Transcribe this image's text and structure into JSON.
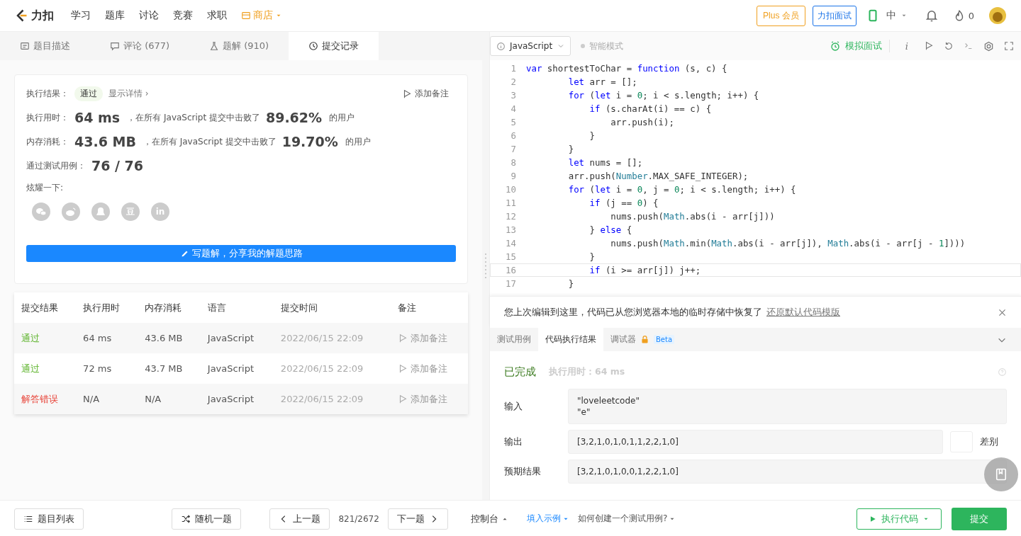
{
  "nav": {
    "logo": "力扣",
    "items": [
      {
        "label": "学习"
      },
      {
        "label": "题库"
      },
      {
        "label": "讨论"
      },
      {
        "label": "竞赛"
      },
      {
        "label": "求职"
      }
    ],
    "store": "商店",
    "plus": "Plus 会员",
    "interview": "力扣面试",
    "lang": "中",
    "points": "0"
  },
  "left_tabs": [
    {
      "label": "题目描述",
      "selected": false
    },
    {
      "label": "评论 (677)",
      "selected": false
    },
    {
      "label": "题解 (910)",
      "selected": false
    },
    {
      "label": "提交记录",
      "selected": true
    }
  ],
  "result": {
    "label": "执行结果：",
    "status": "通过",
    "details": "显示详情 ›",
    "note": "添加备注"
  },
  "stats": [
    {
      "label": "执行用时：",
      "value": "64 ms",
      "mid": "，在所有 JavaScript 提交中击败了",
      "pct": "89.62%",
      "suffix": "的用户"
    },
    {
      "label": "内存消耗：",
      "value": "43.6 MB",
      "mid": "，在所有 JavaScript 提交中击败了",
      "pct": "19.70%",
      "suffix": "的用户"
    }
  ],
  "cases": {
    "label": "通过测试用例：",
    "value": "76 / 76"
  },
  "share_label": "炫耀一下:",
  "share_glyphs": [
    "豆",
    "in"
  ],
  "write_button": "写题解，分享我的解题思路",
  "table": {
    "columns": [
      "提交结果",
      "执行用时",
      "内存消耗",
      "语言",
      "提交时间",
      "备注"
    ],
    "rows": [
      {
        "status": "通过",
        "kind": "pass",
        "time": "64 ms",
        "memory": "43.6 MB",
        "lang": "JavaScript",
        "submitted": "2022/06/15 22:09",
        "note": "添加备注"
      },
      {
        "status": "通过",
        "kind": "pass",
        "time": "72 ms",
        "memory": "43.7 MB",
        "lang": "JavaScript",
        "submitted": "2022/06/15 22:09",
        "note": "添加备注"
      },
      {
        "status": "解答错误",
        "kind": "fail",
        "time": "N/A",
        "memory": "N/A",
        "lang": "JavaScript",
        "submitted": "2022/06/15 22:09",
        "note": "添加备注"
      }
    ]
  },
  "editor": {
    "language": "JavaScript",
    "smart_mode": "智能模式",
    "mock": "模拟面试",
    "info_glyph": "i",
    "lines": [
      {
        "n": "1",
        "current": false,
        "seg": [
          {
            "text": "var",
            "kind": "kw"
          },
          {
            "text": " shortestToChar = "
          },
          {
            "text": "function",
            "kind": "kw"
          },
          {
            "text": " (s, c) {"
          }
        ]
      },
      {
        "n": "2",
        "current": false,
        "seg": [
          {
            "text": "        let",
            "kind": "kw"
          },
          {
            "text": " arr = [];"
          }
        ]
      },
      {
        "n": "3",
        "current": false,
        "seg": [
          {
            "text": "        for",
            "kind": "kw"
          },
          {
            "text": " ("
          },
          {
            "text": "let",
            "kind": "kw"
          },
          {
            "text": " i = "
          },
          {
            "text": "0",
            "kind": "num"
          },
          {
            "text": "; i < s.length; i++) {"
          }
        ]
      },
      {
        "n": "4",
        "current": false,
        "seg": [
          {
            "text": "            if",
            "kind": "kw"
          },
          {
            "text": " (s.charAt(i) == c) {"
          }
        ]
      },
      {
        "n": "5",
        "current": false,
        "seg": [
          {
            "text": "                arr.push(i);"
          }
        ]
      },
      {
        "n": "6",
        "current": false,
        "seg": [
          {
            "text": "            }"
          }
        ]
      },
      {
        "n": "7",
        "current": false,
        "seg": [
          {
            "text": "        }"
          }
        ]
      },
      {
        "n": "8",
        "current": false,
        "seg": [
          {
            "text": "        let",
            "kind": "kw"
          },
          {
            "text": " nums = [];"
          }
        ]
      },
      {
        "n": "9",
        "current": false,
        "seg": [
          {
            "text": "        arr.push("
          },
          {
            "text": "Number",
            "kind": "type"
          },
          {
            "text": ".MAX_SAFE_INTEGER);"
          }
        ]
      },
      {
        "n": "10",
        "current": false,
        "seg": [
          {
            "text": "        for",
            "kind": "kw"
          },
          {
            "text": " ("
          },
          {
            "text": "let",
            "kind": "kw"
          },
          {
            "text": " i = "
          },
          {
            "text": "0",
            "kind": "num"
          },
          {
            "text": ", j = "
          },
          {
            "text": "0",
            "kind": "num"
          },
          {
            "text": "; i < s.length; i++) {"
          }
        ]
      },
      {
        "n": "11",
        "current": false,
        "seg": [
          {
            "text": "            if",
            "kind": "kw"
          },
          {
            "text": " (j == "
          },
          {
            "text": "0",
            "kind": "num"
          },
          {
            "text": ") {"
          }
        ]
      },
      {
        "n": "12",
        "current": false,
        "seg": [
          {
            "text": "                nums.push("
          },
          {
            "text": "Math",
            "kind": "type"
          },
          {
            "text": ".abs(i - arr[j]))"
          }
        ]
      },
      {
        "n": "13",
        "current": false,
        "seg": [
          {
            "text": "            } "
          },
          {
            "text": "else",
            "kind": "kw"
          },
          {
            "text": " {"
          }
        ]
      },
      {
        "n": "14",
        "current": false,
        "seg": [
          {
            "text": "                nums.push("
          },
          {
            "text": "Math",
            "kind": "type"
          },
          {
            "text": ".min("
          },
          {
            "text": "Math",
            "kind": "type"
          },
          {
            "text": ".abs(i - arr[j]), "
          },
          {
            "text": "Math",
            "kind": "type"
          },
          {
            "text": ".abs(i - arr[j - "
          },
          {
            "text": "1",
            "kind": "num"
          },
          {
            "text": "])))"
          }
        ]
      },
      {
        "n": "15",
        "current": false,
        "seg": [
          {
            "text": "            }"
          }
        ]
      },
      {
        "n": "16",
        "current": true,
        "seg": [
          {
            "text": "            if",
            "kind": "kw"
          },
          {
            "text": " (i >= arr[j]) j++;"
          }
        ]
      },
      {
        "n": "17",
        "current": false,
        "seg": [
          {
            "text": "        }"
          }
        ]
      }
    ]
  },
  "banner": {
    "text": "您上次编辑到这里，代码已从您浏览器本地的临时存储中恢复了",
    "link": "还原默认代码模版"
  },
  "console_tabs": [
    {
      "label": "测试用例",
      "selected": false
    },
    {
      "label": "代码执行结果",
      "selected": true
    },
    {
      "label": "调试器",
      "selected": false,
      "badge": "Beta",
      "locked": true
    }
  ],
  "run_result": {
    "status": "已完成",
    "time": "执行用时：64 ms",
    "fields": [
      {
        "label": "输入",
        "lines": [
          "\"loveleetcode\"",
          "\"e\""
        ]
      },
      {
        "label": "输出",
        "lines": [
          "[3,2,1,0,1,0,1,1,2,2,1,0]"
        ],
        "diff": "差别"
      },
      {
        "label": "预期结果",
        "lines": [
          "[3,2,1,0,1,0,0,1,2,2,1,0]"
        ]
      }
    ]
  },
  "bottom": {
    "list": "题目列表",
    "random": "随机一题",
    "prev": "上一题",
    "progress": "821/2672",
    "next": "下一题",
    "console": "控制台",
    "example": "填入示例",
    "howto": "如何创建一个测试用例?",
    "run": "执行代码",
    "submit": "提交"
  }
}
